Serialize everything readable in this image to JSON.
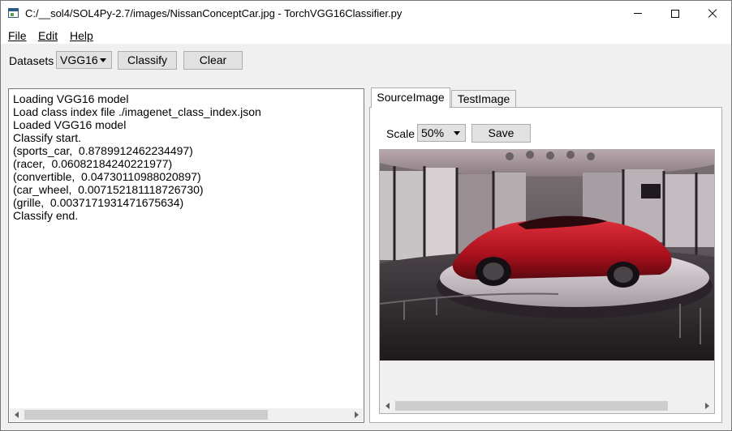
{
  "window": {
    "title": "C:/__sol4/SOL4Py-2.7/images/NissanConceptCar.jpg - TorchVGG16Classifier.py"
  },
  "menu": {
    "file": "File",
    "edit": "Edit",
    "help": "Help"
  },
  "toolbar": {
    "datasets_label": "Datasets",
    "datasets_value": "VGG16",
    "classify_label": "Classify",
    "clear_label": "Clear"
  },
  "log": {
    "lines": [
      "Loading VGG16 model",
      "Load class index file ./imagenet_class_index.json",
      "Loaded VGG16 model",
      "Classify start.",
      "(sports_car,  0.8789912462234497)",
      "(racer,  0.06082184240221977)",
      "(convertible,  0.04730110988020897)",
      "(car_wheel,  0.007152181118726730)",
      "(grille,  0.0037171931471675634)",
      "Classify end."
    ]
  },
  "tabs": {
    "source": "SourceImage",
    "test": "TestImage"
  },
  "image_panel": {
    "scale_label": "Scale",
    "scale_value": "50%",
    "save_label": "Save"
  }
}
